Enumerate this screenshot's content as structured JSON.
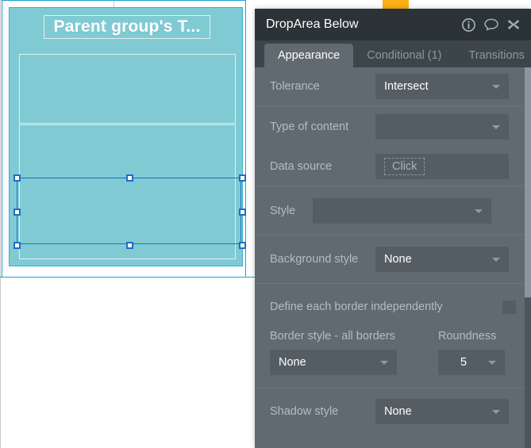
{
  "canvas": {
    "group_title": "Parent group's T...",
    "teal_color": "#80CBD3",
    "selection_color": "#1A6FC4",
    "page_border_color": "#1E9FD4",
    "orange_tab_color": "#FBB016"
  },
  "panel": {
    "title": "DropArea Below",
    "header_icons": [
      {
        "name": "info-icon",
        "glyph": "i"
      },
      {
        "name": "comment-icon",
        "glyph": "speech-bubble"
      },
      {
        "name": "close-icon",
        "glyph": "x"
      }
    ],
    "tabs": [
      {
        "label": "Appearance",
        "active": true
      },
      {
        "label": "Conditional (1)",
        "active": false
      },
      {
        "label": "Transitions",
        "active": false
      }
    ],
    "fields": {
      "tolerance": {
        "label": "Tolerance",
        "value": "Intersect"
      },
      "type_of_content": {
        "label": "Type of content",
        "value": ""
      },
      "data_source": {
        "label": "Data source",
        "button_label": "Click"
      },
      "style": {
        "label": "Style",
        "value": ""
      },
      "background_style": {
        "label": "Background style",
        "value": "None"
      },
      "define_each_border": {
        "label": "Define each border independently",
        "checked": false
      },
      "border_style": {
        "label": "Border style - all borders",
        "value": "None"
      },
      "roundness": {
        "label": "Roundness",
        "value": "5"
      },
      "shadow_style": {
        "label": "Shadow style",
        "value": "None"
      }
    }
  }
}
